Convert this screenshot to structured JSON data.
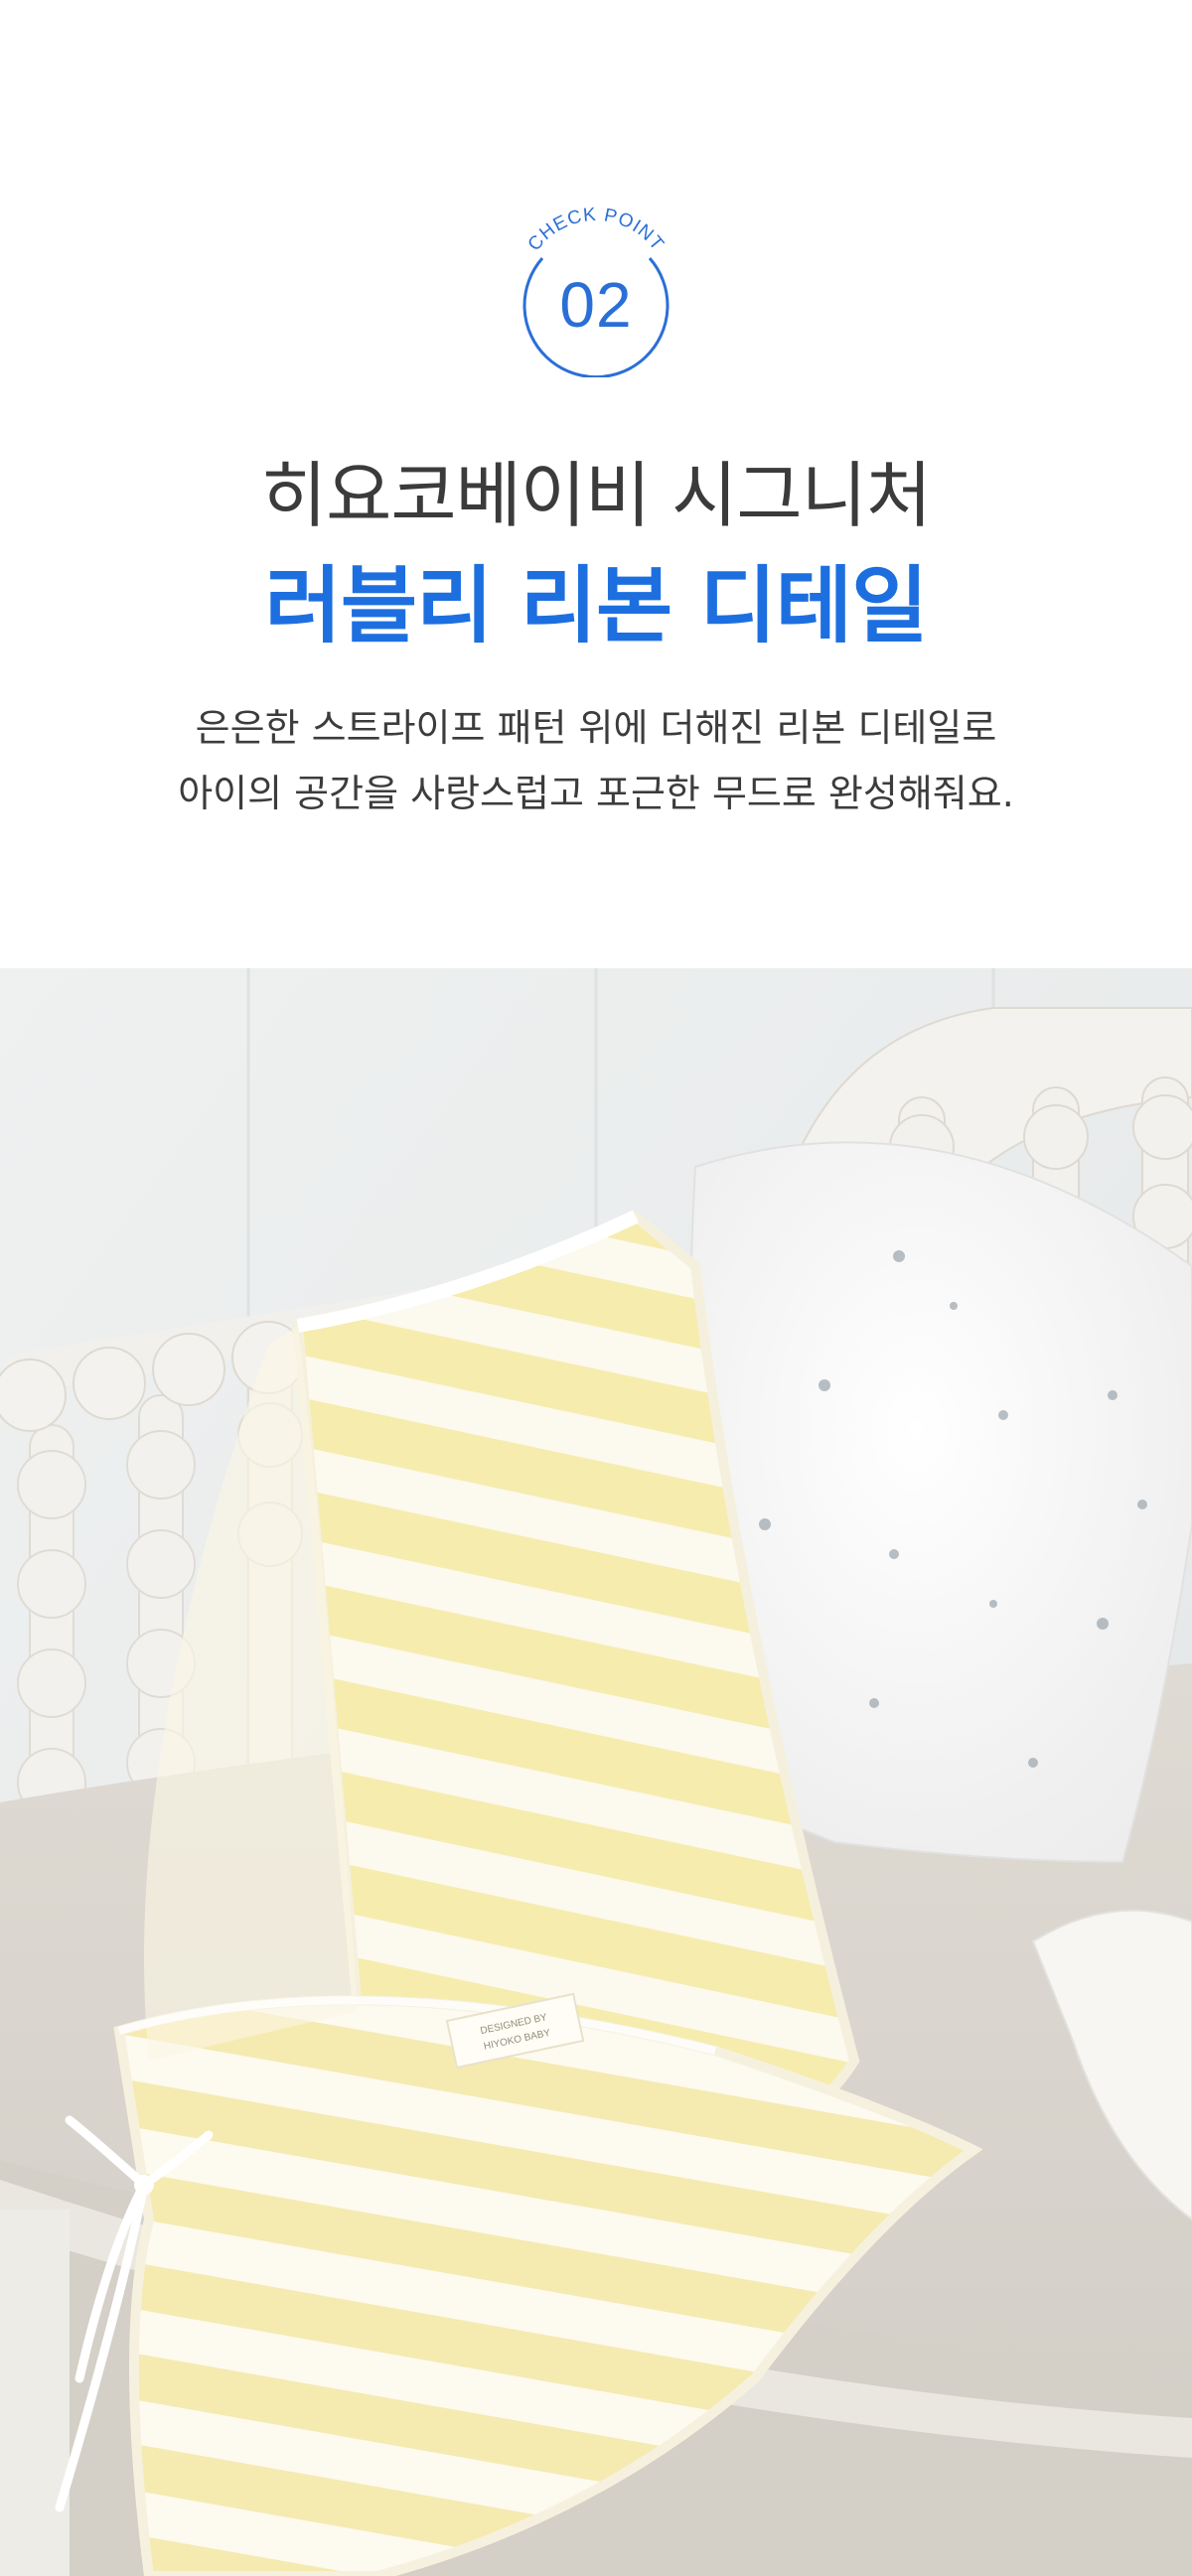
{
  "badge": {
    "label": "CHECK POINT",
    "number": "02",
    "color": "#2a6fd6"
  },
  "title": {
    "line1": "히요코베이비 시그니처",
    "line2": "러블리 리본 디테일",
    "line2_color": "#1d6fe0"
  },
  "description": {
    "line1": "은은한 스트라이프 패턴 위에 더해진 리본 디테일로",
    "line2": "아이의 공간을 사랑스럽고 포근한 무드로 완성해줘요."
  },
  "photo": {
    "subject": "yellow striped baby blanket with ribbon tie draped over a white spindle bench with a floral pillow",
    "label_text_1": "DESIGNED BY",
    "label_text_2": "HIYOKO BABY",
    "stripe_color": "#f6eba8",
    "base_color": "#fbf7e8"
  }
}
